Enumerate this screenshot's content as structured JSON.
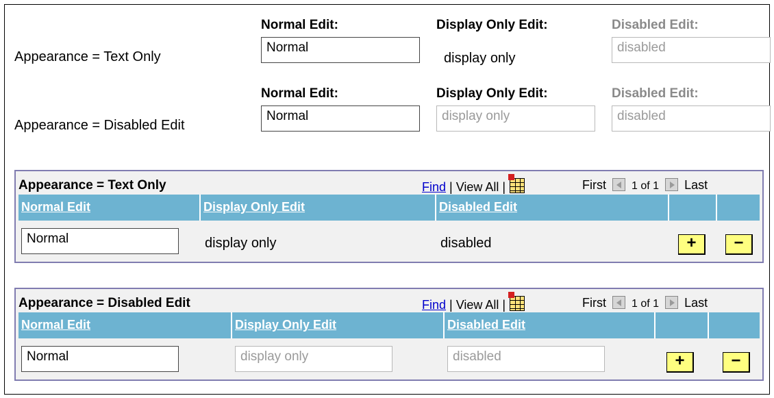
{
  "top": {
    "row1": {
      "label": "Appearance = Text Only",
      "normal_header": "Normal Edit:",
      "normal_value": "Normal",
      "display_header": "Display Only Edit:",
      "display_value": "display only",
      "disabled_header": "Disabled Edit:",
      "disabled_value": "disabled"
    },
    "row2": {
      "label": "Appearance = Disabled Edit",
      "normal_header": "Normal Edit:",
      "normal_value": "Normal",
      "display_header": "Display Only Edit:",
      "display_value": "display only",
      "disabled_header": "Disabled Edit:",
      "disabled_value": "disabled"
    }
  },
  "grid1": {
    "title": "Appearance = Text Only",
    "find": "Find",
    "view_all": "| View All |",
    "first": "First",
    "page": "1 of 1",
    "last": "Last",
    "columns": [
      "Normal Edit",
      "Display Only Edit",
      "Disabled Edit"
    ],
    "row": {
      "normal": "Normal",
      "display": "display only",
      "disabled": "disabled"
    },
    "add_label": "+",
    "delete_label": "−"
  },
  "grid2": {
    "title": "Appearance = Disabled Edit",
    "find": "Find",
    "view_all": "| View All |",
    "first": "First",
    "page": "1 of 1",
    "last": "Last",
    "columns": [
      "Normal Edit",
      "Display Only Edit",
      "Disabled Edit"
    ],
    "row": {
      "normal": "Normal",
      "display": "display only",
      "disabled": "disabled"
    },
    "add_label": "+",
    "delete_label": "−"
  },
  "colors": {
    "grid_border": "#807cb0",
    "grid_header": "#6db3d1",
    "button_fill": "#ffff80",
    "link": "#0000cc"
  }
}
